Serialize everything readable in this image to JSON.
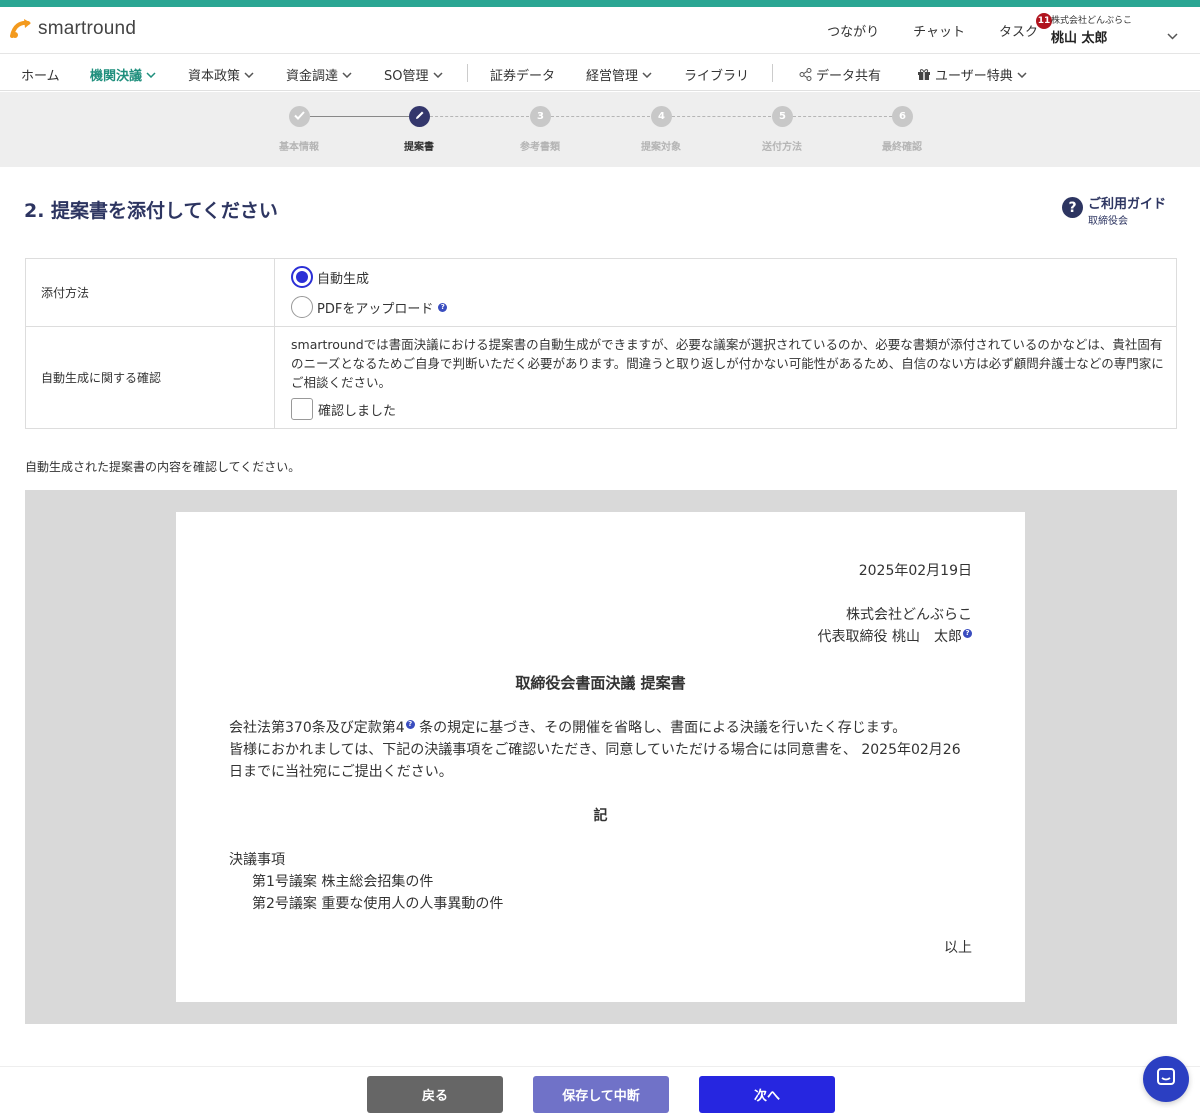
{
  "app": {
    "logo_text": "smartround"
  },
  "header": {
    "links": [
      "つながり",
      "チャット",
      "タスク"
    ],
    "task_badge": "11",
    "user_company": "株式会社どんぶらこ",
    "user_name": "桃山 太郎"
  },
  "nav": {
    "items": [
      "ホーム",
      "機関決議",
      "資本政策",
      "資金調達",
      "SO管理",
      "証券データ",
      "経営管理",
      "ライブラリ",
      "データ共有",
      "ユーザー特典"
    ],
    "active": "機関決議"
  },
  "stepper": {
    "steps": [
      "基本情報",
      "提案書",
      "参考書類",
      "提案対象",
      "送付方法",
      "最終確認"
    ],
    "numbers": [
      "",
      "",
      "3",
      "4",
      "5",
      "6"
    ],
    "current_index": 1
  },
  "page": {
    "title": "2. 提案書を添付してください",
    "guide_title": "ご利用ガイド",
    "guide_sub": "取締役会"
  },
  "form": {
    "attach_label": "添付方法",
    "option_auto": "自動生成",
    "option_pdf": "PDFをアップロード",
    "selected_option": "自動生成",
    "confirm_label": "自動生成に関する確認",
    "confirm_text": "smartroundでは書面決議における提案書の自動生成ができますが、必要な議案が選択されているのか、必要な書類が添付されているのかなどは、貴社固有のニーズとなるためご自身で判断いただく必要があります。間違うと取り返しが付かない可能性があるため、自信のない方は必ず顧問弁護士などの専門家にご相談ください。",
    "checkbox_label": "確認しました",
    "checkbox_checked": false
  },
  "preview": {
    "caption": "自動生成された提案書の内容を確認してください。",
    "date": "2025年02月19日",
    "company": "株式会社どんぶらこ",
    "representative": "代表取締役 桃山　太郎",
    "title": "取締役会書面決議 提案書",
    "body_line1a": "会社法第370条及び定款第4",
    "body_line1b": "条の規定に基づき、その開催を省略し、書面による決議を行いたく存じます。",
    "body_line2": "皆様におかれましては、下記の決議事項をご確認いただき、同意していただける場合には同意書を、 2025年02月26日までに当社宛にご提出ください。",
    "ki": "記",
    "items_heading": "決議事項",
    "items": [
      "第1号議案 株主総会招集の件",
      "第2号議案 重要な使用人の人事異動の件"
    ],
    "end": "以上"
  },
  "footer": {
    "back": "戻る",
    "save": "保存して中断",
    "next": "次へ"
  },
  "colors": {
    "accent": "#2aa693",
    "primary": "#2626e0",
    "navy": "#2d3561"
  }
}
